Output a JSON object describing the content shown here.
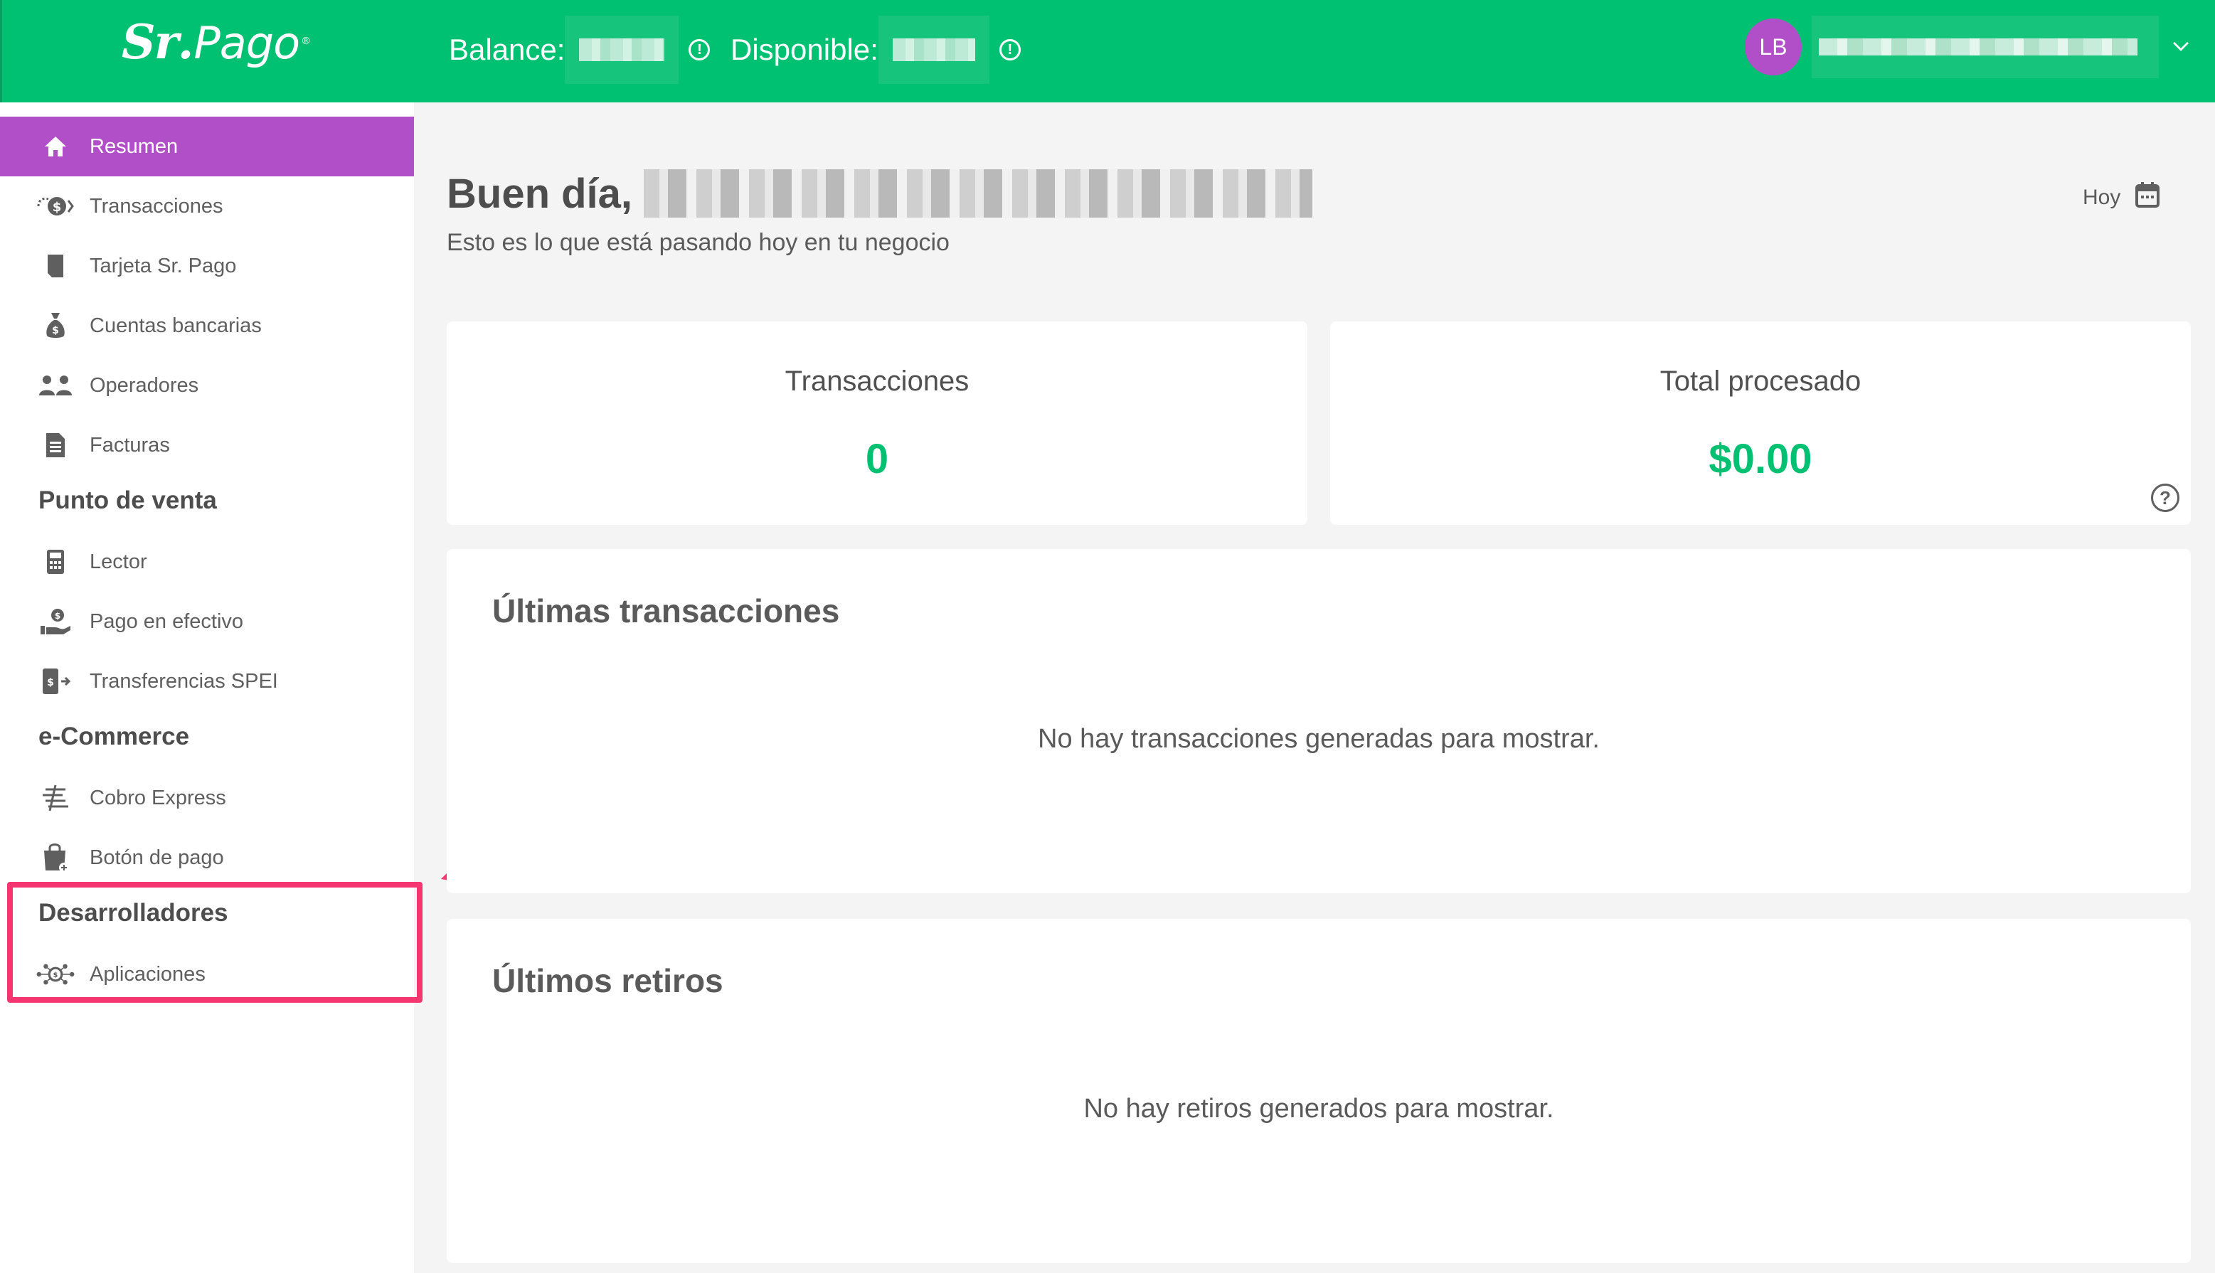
{
  "colors": {
    "brand_green": "#00c172",
    "active_purple": "#b04fc7",
    "highlight_pink": "#f5356f"
  },
  "topbar": {
    "logo_sr": "Sr",
    "logo_pago": "Pago",
    "balance_label": "Balance:",
    "disponible_label": "Disponible:",
    "avatar_initials": "LB"
  },
  "sidebar": {
    "items": [
      {
        "label": "Resumen",
        "icon": "home-icon"
      },
      {
        "label": "Transacciones",
        "icon": "money-transfer-icon"
      },
      {
        "label": "Tarjeta Sr. Pago",
        "icon": "card-icon"
      },
      {
        "label": "Cuentas bancarias",
        "icon": "money-bag-icon"
      },
      {
        "label": "Operadores",
        "icon": "users-icon"
      },
      {
        "label": "Facturas",
        "icon": "invoice-icon"
      }
    ],
    "section_pos": "Punto de venta",
    "pos_items": [
      {
        "label": "Lector",
        "icon": "card-reader-icon"
      },
      {
        "label": "Pago en efectivo",
        "icon": "cash-hand-icon"
      },
      {
        "label": "Transferencias SPEI",
        "icon": "phone-transfer-icon"
      }
    ],
    "section_ecommerce": "e-Commerce",
    "ecommerce_items": [
      {
        "label": "Cobro Express",
        "icon": "express-payment-icon"
      },
      {
        "label": "Botón de pago",
        "icon": "shopping-bag-icon"
      }
    ],
    "section_dev": "Desarrolladores",
    "dev_items": [
      {
        "label": "Aplicaciones",
        "icon": "network-apps-icon"
      }
    ]
  },
  "main": {
    "greeting": "Buen día,",
    "subtitle": "Esto es lo que está pasando hoy en tu negocio",
    "date_filter": "Hoy",
    "stats": [
      {
        "title": "Transacciones",
        "value": "0"
      },
      {
        "title": "Total procesado",
        "value": "$0.00"
      }
    ],
    "last_transactions": {
      "title": "Últimas transacciones",
      "empty": "No hay transacciones generadas para mostrar."
    },
    "last_withdrawals": {
      "title": "Últimos retiros",
      "empty": "No hay retiros generados para mostrar."
    }
  }
}
